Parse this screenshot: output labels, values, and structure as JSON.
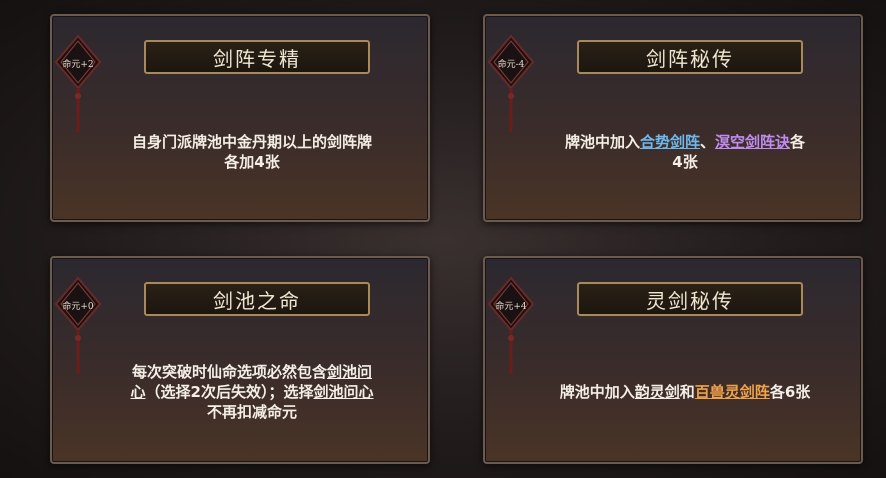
{
  "cards": [
    {
      "badge": "命元+2",
      "title": "剑阵专精",
      "desc_line1": "自身门派牌池中金丹期以上的剑阵牌",
      "desc_line2": "各加4张"
    },
    {
      "badge": "命元-4",
      "title": "剑阵秘传",
      "desc_prefix": "牌池中加入",
      "link1": "合势剑阵",
      "sep": "、",
      "link2": "溟空剑阵诀",
      "desc_suffix": "各",
      "desc_line2": "4张"
    },
    {
      "badge": "命元+0",
      "title": "剑池之命",
      "desc_a": "每次突破时仙命选项必然包含",
      "link_a1": "剑池问",
      "link_a2": "心",
      "desc_b": "（选择2次后失效）；选择",
      "link_b": "剑池问心",
      "desc_line3": "不再扣减命元"
    },
    {
      "badge": "命元+4",
      "title": "灵剑秘传",
      "desc_prefix": "牌池中加入",
      "link1": "韵灵剑",
      "mid": "和",
      "link2": "百兽灵剑阵",
      "desc_suffix": "各6张"
    }
  ],
  "colors": {
    "blue_link": "#6fb8ee",
    "purple_link": "#c08cf0",
    "orange_link": "#f0a24a",
    "title_border": "#a8895a"
  }
}
